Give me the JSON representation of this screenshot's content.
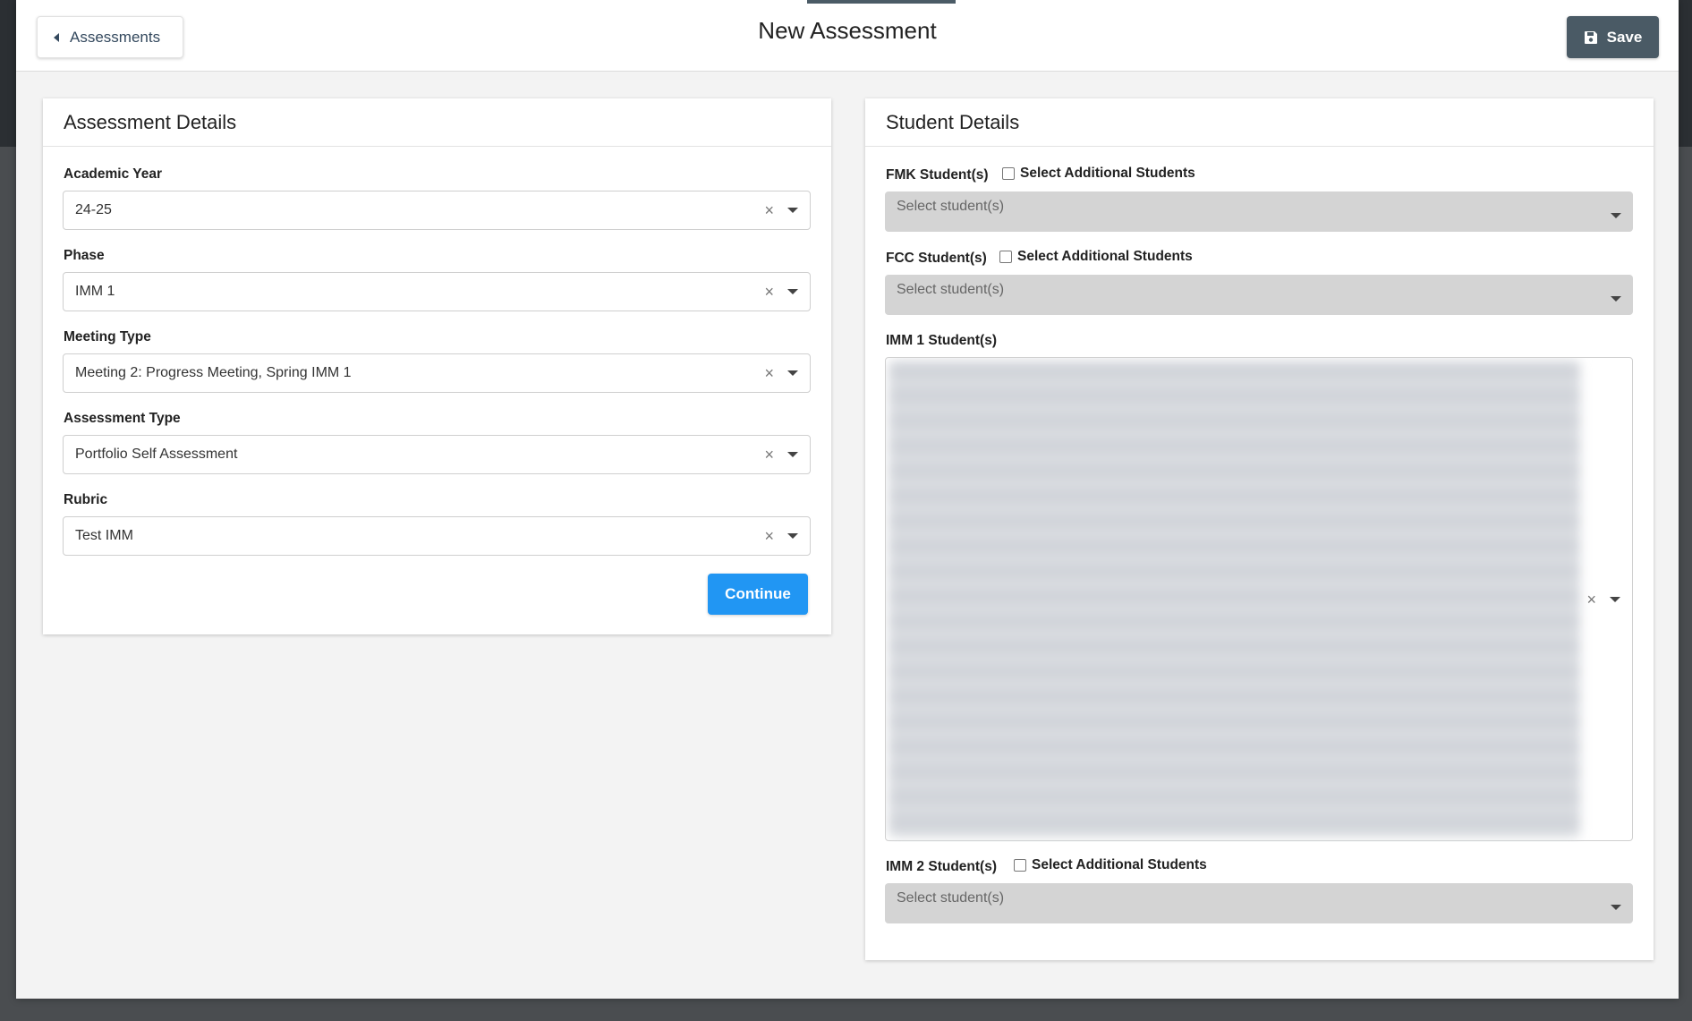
{
  "header": {
    "back_label": "Assessments",
    "title": "New Assessment",
    "save_label": "Save"
  },
  "assessment_details": {
    "heading": "Assessment Details",
    "fields": [
      {
        "label": "Academic Year",
        "value": "24-25"
      },
      {
        "label": "Phase",
        "value": "IMM 1"
      },
      {
        "label": "Meeting Type",
        "value": "Meeting 2: Progress Meeting, Spring IMM 1"
      },
      {
        "label": "Assessment Type",
        "value": "Portfolio Self Assessment"
      },
      {
        "label": "Rubric",
        "value": "Test IMM"
      }
    ],
    "continue_label": "Continue"
  },
  "student_details": {
    "heading": "Student Details",
    "fmk": {
      "label": "FMK Student(s)",
      "checkbox_label": "Select Additional Students",
      "placeholder": "Select student(s)"
    },
    "fcc": {
      "label": "FCC Student(s)",
      "checkbox_label": "Select Additional Students",
      "placeholder": "Select student(s)"
    },
    "imm1": {
      "label": "IMM 1 Student(s)"
    },
    "imm2": {
      "label": "IMM 2 Student(s)",
      "checkbox_label": "Select Additional Students",
      "placeholder": "Select student(s)"
    }
  },
  "icons": {
    "clear": "×"
  },
  "colors": {
    "save_button": "#4a5a65",
    "continue_button": "#2196f3",
    "disabled_select": "#d4d4d4"
  }
}
